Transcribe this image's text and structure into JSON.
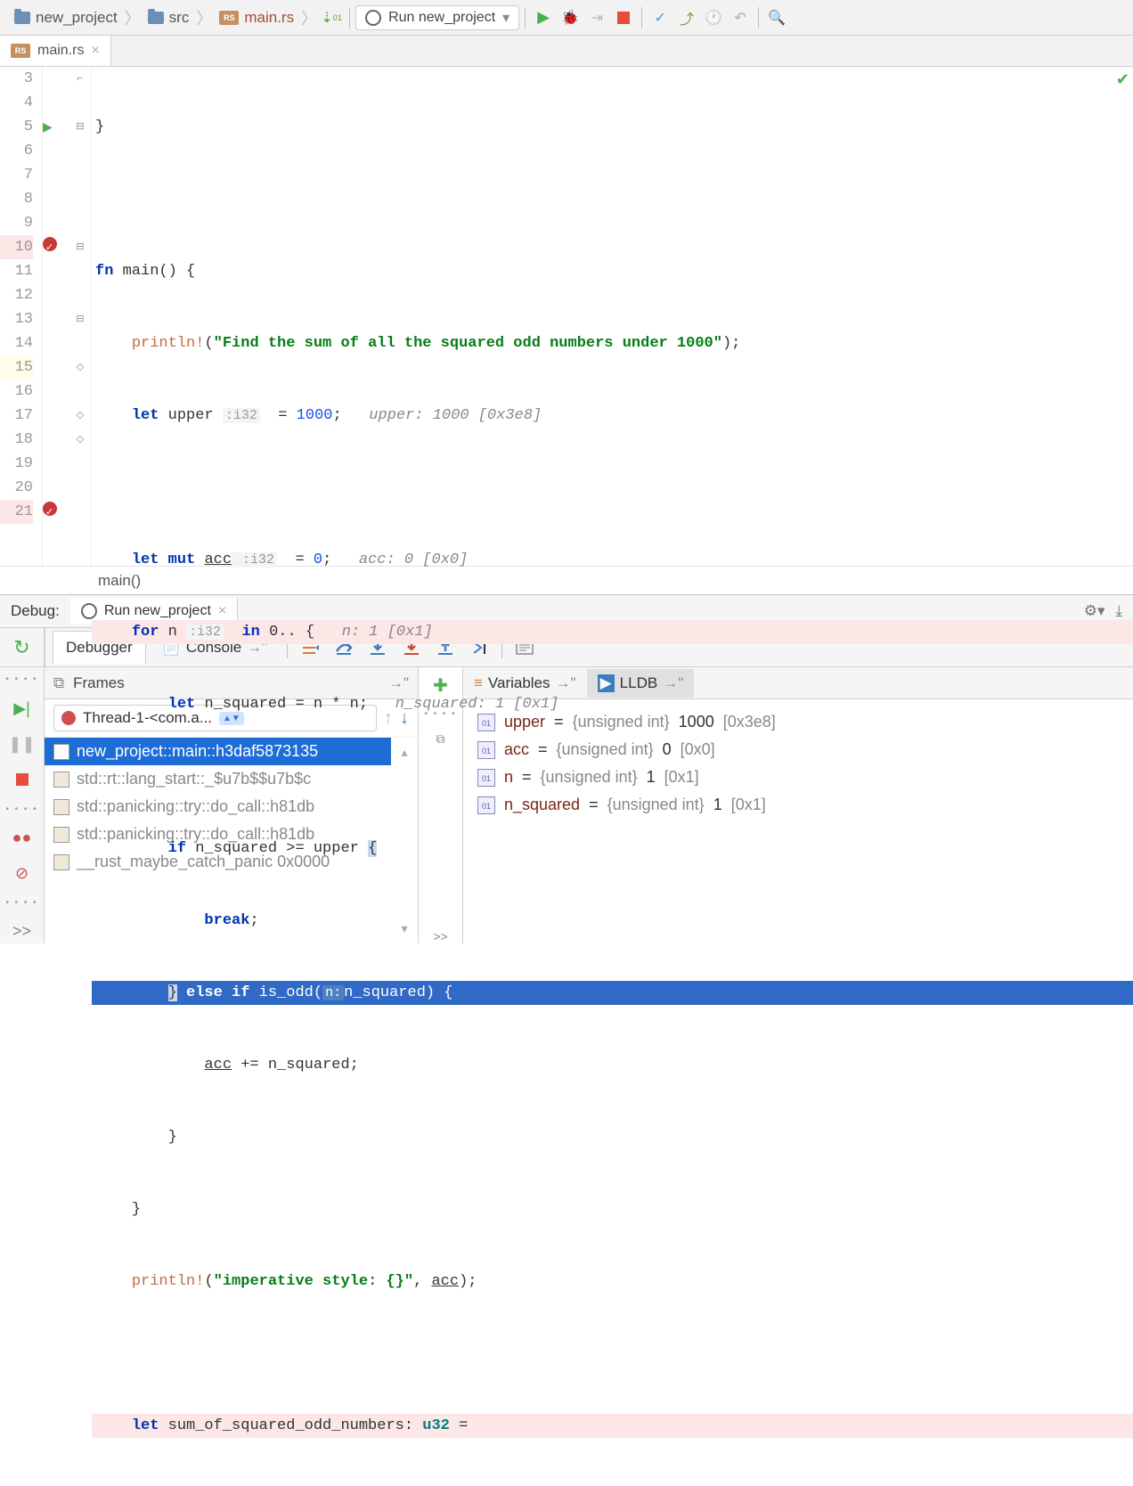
{
  "breadcrumb": {
    "project": "new_project",
    "folder": "src",
    "file": "main.rs"
  },
  "run_config": "Run new_project",
  "tab": {
    "name": "main.rs"
  },
  "editor": {
    "lines": [
      "3",
      "4",
      "5",
      "6",
      "7",
      "8",
      "9",
      "10",
      "11",
      "12",
      "13",
      "14",
      "15",
      "16",
      "17",
      "18",
      "19",
      "20",
      "21"
    ],
    "l3": "}",
    "l5_fn": "fn ",
    "l5_main": "main() {",
    "l6_mac": "println!",
    "l6_str": "\"Find the sum of all the squared odd numbers under 1000\"",
    "l6_end": ");",
    "l7_let": "let ",
    "l7_var": "upper ",
    "l7_hint": ":i32",
    "l7_eq": "  = ",
    "l7_num": "1000",
    "l7_semi": ";   ",
    "l7_cmt": "upper: 1000 [0x3e8]",
    "l9_let": "let mut ",
    "l9_var": "acc",
    "l9_hint": " :i32",
    "l9_eq": "  = ",
    "l9_num": "0",
    "l9_semi": ";   ",
    "l9_cmt": "acc: 0 [0x0]",
    "l10_for": "for ",
    "l10_var": "n ",
    "l10_hint": ":i32",
    "l10_in": "  in ",
    "l10_rng": "0.. {   ",
    "l10_cmt": "n: 1 [0x1]",
    "l11_let": "let ",
    "l11_rest": "n_squared = n * n;   ",
    "l11_cmt": "n_squared: 1 [0x1]",
    "l13_if": "if ",
    "l13_cond": "n_squared >= upper ",
    "l13_brace": "{",
    "l14_break": "break",
    "l14_semi": ";",
    "l15_close": "}",
    "l15_else": " else if ",
    "l15_fn": "is_odd(",
    "l15_hint": "n:",
    "l15_arg": "n_squared) {",
    "l16_acc": "acc",
    "l16_rest": " += n_squared;",
    "l17": "}",
    "l18": "}",
    "l19_mac": "println!",
    "l19_str": "\"imperative style: {}\"",
    "l19_mid": ", ",
    "l19_acc": "acc",
    "l19_end": ");",
    "l21_let": "let ",
    "l21_var": "sum_of_squared_odd_numbers: ",
    "l21_ty": "u32",
    "l21_eq": " =",
    "bottom_crumb": "main()"
  },
  "debug": {
    "label": "Debug:",
    "tab_name": "Run new_project",
    "debugger_tab": "Debugger",
    "console_tab": "Console",
    "frames_label": "Frames",
    "variables_label": "Variables",
    "lldb_label": "LLDB",
    "thread": "Thread-1-<com.a...",
    "frames": [
      "new_project::main::h3daf5873135",
      "std::rt::lang_start::_$u7b$$u7b$c",
      "std::panicking::try::do_call::h81db",
      "std::panicking::try::do_call::h81db",
      "__rust_maybe_catch_panic 0x0000"
    ],
    "vars": [
      {
        "name": "upper",
        "type": "{unsigned int}",
        "val": "1000",
        "hex": "[0x3e8]"
      },
      {
        "name": "acc",
        "type": "{unsigned int}",
        "val": "0",
        "hex": "[0x0]"
      },
      {
        "name": "n",
        "type": "{unsigned int}",
        "val": "1",
        "hex": "[0x1]"
      },
      {
        "name": "n_squared",
        "type": "{unsigned int}",
        "val": "1",
        "hex": "[0x1]"
      }
    ],
    "more": ">>"
  }
}
